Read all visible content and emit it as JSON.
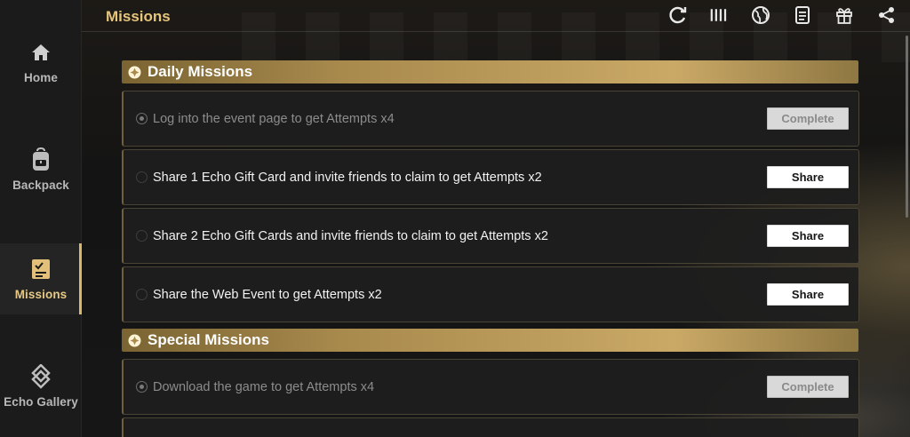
{
  "sidebar": {
    "items": [
      {
        "label": "Home",
        "icon": "home-icon"
      },
      {
        "label": "Backpack",
        "icon": "backpack-icon"
      },
      {
        "label": "Missions",
        "icon": "missions-icon",
        "active": true
      },
      {
        "label": "Echo Gallery",
        "icon": "echo-gallery-icon"
      }
    ]
  },
  "header": {
    "title": "Missions",
    "tools": [
      "refresh-icon",
      "menu-bars-icon",
      "globe-icon",
      "notes-icon",
      "gift-icon",
      "share-icon"
    ]
  },
  "daily": {
    "title": "Daily Missions",
    "missions": [
      {
        "text": "Log into the event page to get Attempts x4",
        "action": "Complete",
        "done": true
      },
      {
        "text": "Share 1 Echo Gift Card and invite friends to claim to get Attempts x2",
        "action": "Share",
        "done": false
      },
      {
        "text": "Share 2 Echo Gift Cards and invite friends to claim to get Attempts x2",
        "action": "Share",
        "done": false
      },
      {
        "text": "Share the Web Event to get Attempts x2",
        "action": "Share",
        "done": false
      }
    ]
  },
  "special": {
    "title": "Special Missions",
    "missions": [
      {
        "text": "Download the game to get Attempts x4",
        "action": "Complete",
        "done": true
      }
    ]
  },
  "colors": {
    "accent_gold": "#e6c57c",
    "header_gold": "#caa966",
    "background": "#141414"
  }
}
